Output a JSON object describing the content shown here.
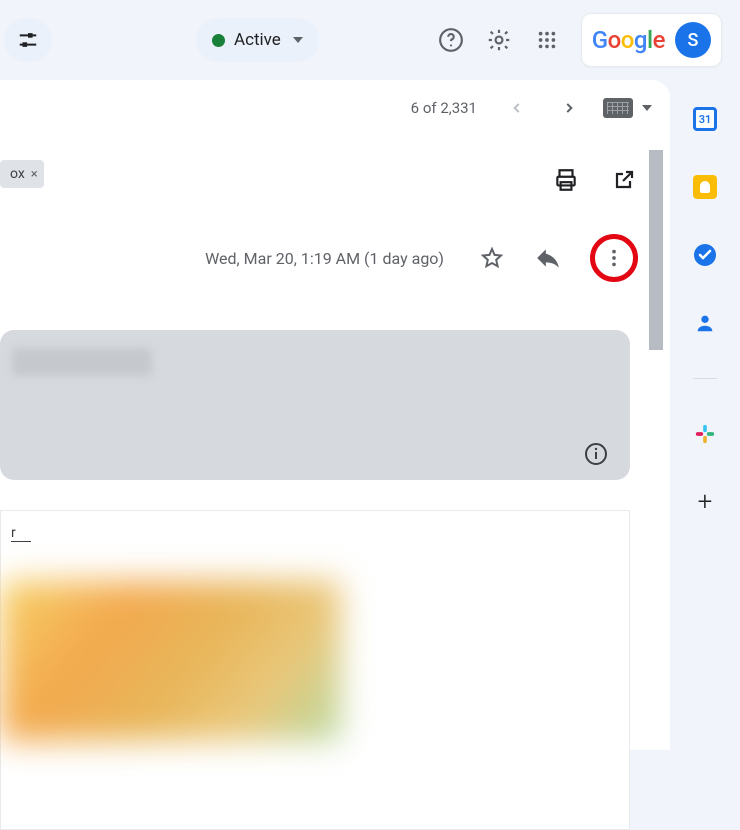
{
  "header": {
    "status_label": "Active",
    "avatar_initial": "S",
    "brand": {
      "c1": "G",
      "c2": "o",
      "c3": "o",
      "c4": "g",
      "c5": "l",
      "c6": "e"
    }
  },
  "toolbar": {
    "paging_text": "6 of 2,331"
  },
  "label_chip": {
    "suffix": "ox",
    "close": "×"
  },
  "message": {
    "date_text": "Wed, Mar 20, 1:19 AM (1 day ago)"
  },
  "body_link": {
    "text": "r"
  },
  "sidepanel": {
    "calendar_day": "31"
  }
}
